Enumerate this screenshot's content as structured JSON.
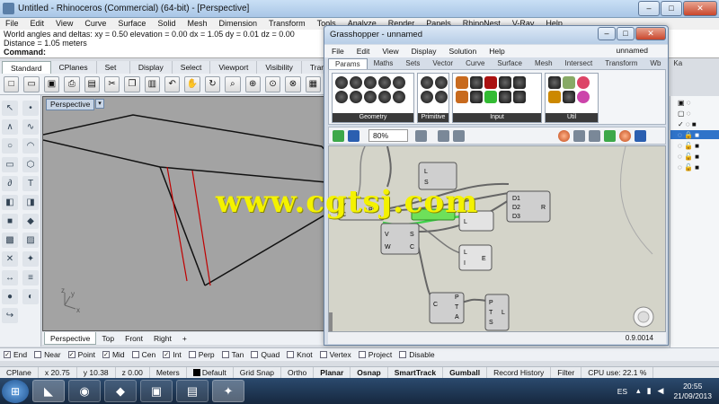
{
  "rhino": {
    "title": "Untitled - Rhinoceros (Commercial) (64-bit) - [Perspective]",
    "window_buttons": [
      "–",
      "□",
      "✕"
    ],
    "menu": [
      "File",
      "Edit",
      "View",
      "Curve",
      "Surface",
      "Solid",
      "Mesh",
      "Dimension",
      "Transform",
      "Tools",
      "Analyze",
      "Render",
      "Panels",
      "RhinoNest",
      "V-Ray",
      "Help"
    ],
    "command_history": [
      "World angles and deltas:     xy = 0.50  elevation = 0.00   dx = 1.05  dy = 0.01  dz = 0.00",
      "Distance = 1.05 meters"
    ],
    "command_prompt": "Command:",
    "toolbar_tabs": [
      "Standard",
      "CPlanes",
      "Set View",
      "Display",
      "Select",
      "Viewport Layout",
      "Visibility",
      "Transform"
    ],
    "viewport": {
      "label": "Perspective",
      "dropdown": "▾",
      "tabs": [
        "Perspective",
        "Top",
        "Front",
        "Right",
        "+"
      ],
      "axis_x": "x",
      "axis_y": "y",
      "axis_z": "z"
    },
    "osnaps": [
      {
        "label": "End",
        "checked": true
      },
      {
        "label": "Near",
        "checked": false
      },
      {
        "label": "Point",
        "checked": true
      },
      {
        "label": "Mid",
        "checked": true
      },
      {
        "label": "Cen",
        "checked": false
      },
      {
        "label": "Int",
        "checked": true
      },
      {
        "label": "Perp",
        "checked": false
      },
      {
        "label": "Tan",
        "checked": false
      },
      {
        "label": "Quad",
        "checked": false
      },
      {
        "label": "Knot",
        "checked": false
      },
      {
        "label": "Vertex",
        "checked": false
      },
      {
        "label": "Project",
        "checked": false
      },
      {
        "label": "Disable",
        "checked": false
      }
    ],
    "status": {
      "cplane": "CPlane",
      "x": "x 20.75",
      "y": "y 10.38",
      "z": "z 0.00",
      "units": "Meters",
      "layer": "Default",
      "grid_snap": "Grid Snap",
      "ortho": "Ortho",
      "planar": "Planar",
      "osnap": "Osnap",
      "smarttrack": "SmartTrack",
      "gumball": "Gumball",
      "record_history": "Record History",
      "filter": "Filter",
      "cpu": "CPU use: 22.1 %"
    }
  },
  "grasshopper": {
    "title": "Grasshopper - unnamed",
    "window_buttons": [
      "–",
      "□",
      "✕"
    ],
    "menu": [
      "File",
      "Edit",
      "View",
      "Display",
      "Solution",
      "Help"
    ],
    "document": "unnamed",
    "tabs": [
      "Params",
      "Maths",
      "Sets",
      "Vector",
      "Curve",
      "Surface",
      "Mesh",
      "Intersect",
      "Transform",
      "Wb",
      "Ka"
    ],
    "groups": [
      "Geometry",
      "Primitive",
      "Input",
      "Util"
    ],
    "zoom": "80%",
    "version": "0.9.0014",
    "components": [
      {
        "name": "comp-1",
        "inputs": [
          "",
          ""
        ],
        "outputs": [
          "L",
          "S"
        ]
      },
      {
        "name": "comp-2",
        "inputs": [
          "V",
          "C"
        ],
        "outputs": [
          "Pl"
        ]
      },
      {
        "name": "comp-3",
        "inputs": [
          "V",
          "W"
        ],
        "outputs": [
          "S",
          "C"
        ]
      },
      {
        "name": "comp-4",
        "inputs": [
          "L"
        ],
        "outputs": [
          ""
        ]
      },
      {
        "name": "comp-5",
        "inputs": [
          "D1",
          "D2",
          "D3"
        ],
        "outputs": [
          "R"
        ]
      },
      {
        "name": "comp-6",
        "inputs": [
          "L",
          "I"
        ],
        "outputs": [
          "E"
        ]
      },
      {
        "name": "comp-7",
        "inputs": [
          "C"
        ],
        "outputs": [
          "P",
          "T",
          "A"
        ]
      },
      {
        "name": "comp-8",
        "inputs": [
          "P",
          "T",
          "S"
        ],
        "outputs": [
          "L"
        ]
      }
    ]
  },
  "watermark": "www.cgtsj.com",
  "taskbar": {
    "start": "⊞",
    "apps": [
      "Rhino",
      "Chrome",
      "Dropbox",
      "Media",
      "Photos",
      "Grasshopper"
    ],
    "language": "ES",
    "time": "20:55",
    "date": "21/09/2013"
  },
  "colors": {
    "viewport_bg": "#a3a3a3",
    "canvas_bg": "#d4d4c9",
    "wire_selected": "#3fd34a",
    "watermark": "#f4f200",
    "edge_red": "#c00000"
  }
}
